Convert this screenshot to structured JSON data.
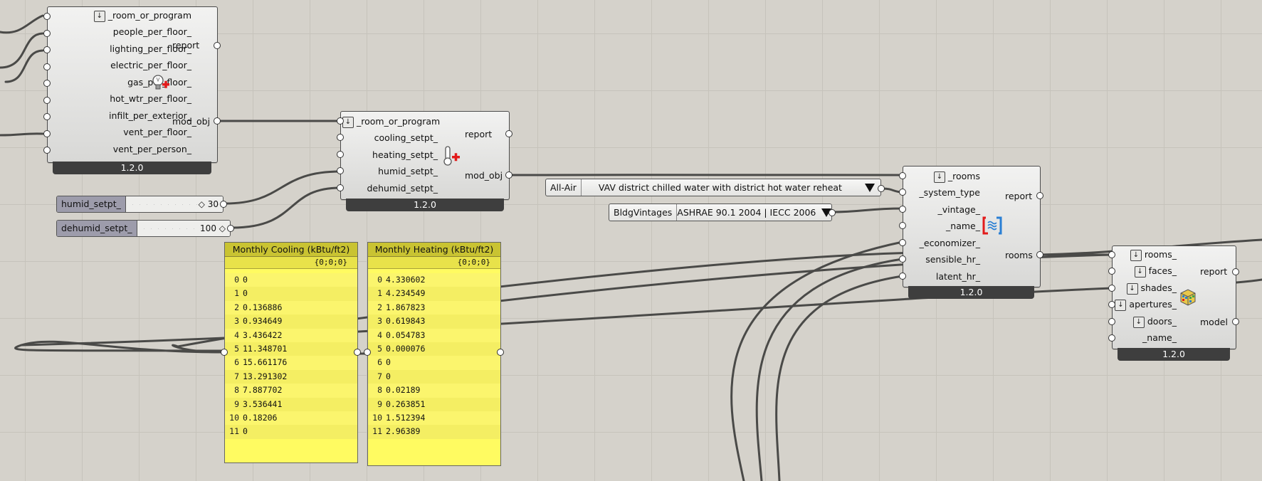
{
  "canvas": {
    "background_color": "#d5d2cb",
    "wire_color": "#4a4a48",
    "panel_color": "#fffb61"
  },
  "load_node": {
    "inputs": [
      "_room_or_program",
      "people_per_floor_",
      "lighting_per_floor_",
      "electric_per_floor_",
      "gas_per_floor_",
      "hot_wtr_per_floor_",
      "infilt_per_exterior_",
      "vent_per_floor_",
      "vent_per_person_"
    ],
    "outputs": [
      "report",
      "mod_obj"
    ],
    "version": "1.2.0",
    "icon": "lightbulb-plus-icon"
  },
  "setpoint_node": {
    "inputs": [
      "_room_or_program",
      "cooling_setpt_",
      "heating_setpt_",
      "humid_setpt_",
      "dehumid_setpt_"
    ],
    "outputs": [
      "report",
      "mod_obj"
    ],
    "version": "1.2.0",
    "icon": "thermometer-plus-icon"
  },
  "hvac_node": {
    "inputs": [
      "_rooms",
      "_system_type",
      "_vintage_",
      "_name_",
      "_economizer_",
      "sensible_hr_",
      "latent_hr_"
    ],
    "outputs": [
      "report",
      "rooms"
    ],
    "version": "1.2.0",
    "icon": "hvac-exchange-icon"
  },
  "model_node": {
    "inputs": [
      "rooms_",
      "faces_",
      "shades_",
      "apertures_",
      "doors_",
      "_name_"
    ],
    "outputs": [
      "report",
      "model"
    ],
    "version": "1.2.0",
    "icon": "model-cube-icon"
  },
  "sliders": [
    {
      "label": "humid_setpt_",
      "value": "30"
    },
    {
      "label": "dehumid_setpt_",
      "value": "100"
    }
  ],
  "value_lists": [
    {
      "key": "All-Air",
      "value": "VAV district chilled water with district hot water reheat"
    },
    {
      "key": "BldgVintages",
      "value": "ASHRAE 90.1 2004  |  IECC 2006"
    }
  ],
  "panels": [
    {
      "title": "Monthly Cooling (kBtu/ft2)",
      "path": "{0;0;0}",
      "rows": [
        "0",
        "0",
        "0.136886",
        "0.934649",
        "3.436422",
        "11.348701",
        "15.661176",
        "13.291302",
        "7.887702",
        "3.536441",
        "0.18206",
        "0"
      ]
    },
    {
      "title": "Monthly Heating (kBtu/ft2)",
      "path": "{0;0;0}",
      "rows": [
        "4.330602",
        "4.234549",
        "1.867823",
        "0.619843",
        "0.054783",
        "0.000076",
        "0",
        "0",
        "0.02189",
        "0.263851",
        "1.512394",
        "2.96389"
      ]
    }
  ]
}
